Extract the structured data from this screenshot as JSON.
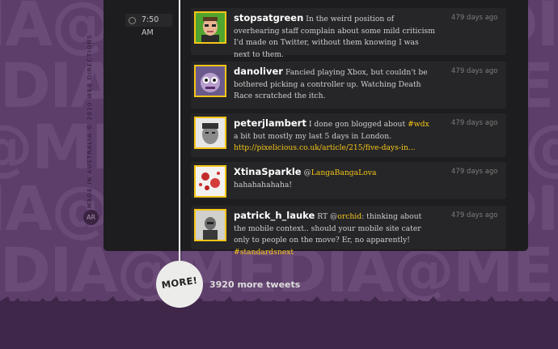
{
  "background": {
    "pattern_text": [
      "IA@MEDIA@MEDIA@M",
      "EDIA@MEDIA@MEDIA",
      "@MEDIA@MEDIA@MED",
      "IA@MEDIA@MEDIA@M",
      "EDIA@MEDIA@MEDIA"
    ],
    "colors": {
      "page": "#5d3d6a",
      "band": "#3f2749"
    }
  },
  "sidebar": {
    "vertical_text": "MADE IN AUSTRALIA © 2010 WEB DIRECTIONS",
    "badge": "AR"
  },
  "timeline": {
    "time_label": "7:50 AM"
  },
  "tweets": [
    {
      "user": "stopsatgreen",
      "text": [
        {
          "t": "In the weird position of overhearing staff complain about some mild criticism I'd made on Twitter, without them knowing I was next to them."
        }
      ],
      "age": "479 days ago"
    },
    {
      "user": "danoliver",
      "text": [
        {
          "t": "Fancied playing Xbox, but couldn't be bothered picking a controller up. Watching Death Race scratched the itch."
        }
      ],
      "age": "479 days ago"
    },
    {
      "user": "peterjlambert",
      "text": [
        {
          "t": "I done gon blogged about "
        },
        {
          "t": "#wdx",
          "hl": true
        },
        {
          "t": " a bit but mostly my last 5 days in London. "
        },
        {
          "t": "http://pixelicious.co.uk/article/215/five-days-in...",
          "hl": true
        }
      ],
      "age": "479 days ago"
    },
    {
      "user": "XtinaSparkle",
      "text": [
        {
          "t": "@"
        },
        {
          "t": "LangaBangaLova",
          "hl": true
        },
        {
          "t": " hahahahahaha!"
        }
      ],
      "age": "479 days ago"
    },
    {
      "user": "patrick_h_lauke",
      "text": [
        {
          "t": "RT @"
        },
        {
          "t": "orchid",
          "hl": true
        },
        {
          "t": ": thinking about the mobile context.. should your mobile site cater only to people on the move? Er, no apparently! "
        },
        {
          "t": "#standardsnext",
          "hl": true
        }
      ],
      "age": "479 days ago"
    }
  ],
  "more": {
    "button_label": "MORE!",
    "count_label": "3920 more tweets"
  },
  "colors": {
    "accent": "#f5c518",
    "panel": "#1d1d1f",
    "card": "#262628"
  }
}
